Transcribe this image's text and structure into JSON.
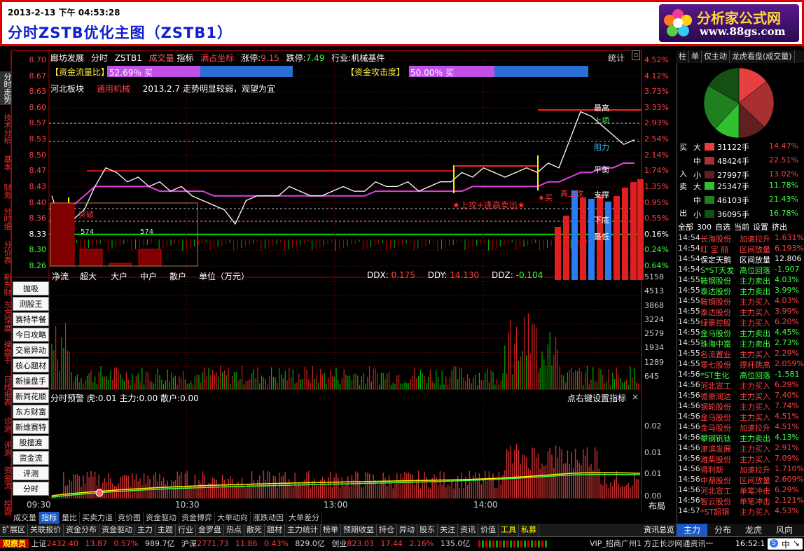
{
  "header": {
    "datetime": "2013-2-13 下午 04:53:28",
    "title": "分时ZSTB优化主图（ZSTB1）",
    "logo_title": "分析家公式网",
    "logo_url_text": "www.88gs.com"
  },
  "vertical_tabs": [
    "分时走势",
    "技术分析",
    "基本",
    "财务",
    "分时细",
    "分价表",
    "新东财",
    "东方深度",
    "操盘手",
    "日线报表",
    "诊测",
    "评测",
    "资金流",
    "控盘"
  ],
  "info_bar": {
    "stock": "廊坊发展",
    "mode": "分时",
    "formula": "ZSTB1",
    "volume_label": "成交量",
    "indicator_label": "指标",
    "coord_label": "满占坐标",
    "limit_up_label": "涨停:",
    "limit_up": "9.15",
    "limit_down_label": "跌停:",
    "limit_down": "7.49",
    "industry": "行业:机械基件",
    "stats": "统计"
  },
  "fund_bars": {
    "flow_label": "【资金流量比】",
    "flow_value": "52.69％ 买",
    "flow_fill": 0.53,
    "attack_label": "【资金攻击度】",
    "attack_value": "50.00％ 买",
    "attack_fill": 0.5
  },
  "board_line": {
    "board": "河北板块",
    "sector": "通用机械",
    "note": "2013.2.7 走势明显较弱，观望为宜"
  },
  "price_axis": [
    "8.70",
    "8.67",
    "8.63",
    "8.60",
    "8.57",
    "8.53",
    "8.50",
    "8.47",
    "8.43",
    "8.40",
    "8.36",
    "8.33",
    "8.30",
    "8.26"
  ],
  "pct_axis": [
    "4.52%",
    "4.12%",
    "3.73%",
    "3.33%",
    "2.93%",
    "2.54%",
    "2.14%",
    "1.74%",
    "1.35%",
    "0.95%",
    "0.55%",
    "0.16%",
    "0.24%",
    "0.64%"
  ],
  "levels": {
    "high": "最高",
    "upper": "上项",
    "resist": "阻力",
    "balance": "平衡",
    "support": "支撑",
    "bottom": "下底",
    "lowest": "最低"
  },
  "annotations": {
    "sell_signal": "★上攻+逢高卖出★",
    "buy_signal": "★买",
    "breakout": "突破",
    "cost": "574",
    "cost2": "574",
    "note_left": "高上攻"
  },
  "order_bars": {
    "labels": [
      "净流",
      "超大",
      "大户",
      "中户",
      "散户"
    ],
    "unit": "单位（万元）",
    "ddx_label": "DDX:",
    "ddx": "0.175",
    "ddy_label": "DDY:",
    "ddy": "14.130",
    "ddz_label": "DDZ:",
    "ddz": "-0.104"
  },
  "side_buttons": [
    "抛吸",
    "测股王",
    "赛特早餐",
    "今日攻略",
    "交易异动",
    "核心题材",
    "新操盘手",
    "新同花顺",
    "东方财富",
    "新维赛特",
    "股摆渡",
    "资金流",
    "评测",
    "分时MACD"
  ],
  "volume_axis": [
    "5158",
    "4513",
    "3868",
    "3224",
    "2579",
    "1934",
    "1289",
    "645"
  ],
  "indicator_panel": {
    "title": "分时预警",
    "tiger": "虎:0.01",
    "main": "主力:0.00",
    "retail": "散户:0.00",
    "hint": "点右键设置指标",
    "close": "×",
    "axis": [
      "0.02",
      "0.01",
      "0.01",
      "0.00"
    ]
  },
  "time_axis": [
    "09:30",
    "10:30",
    "13:00",
    "14:00"
  ],
  "layout_label": "布局",
  "bottom_tabs_1": [
    "成交量",
    "指标",
    "量比",
    "买卖力道",
    "竞价图",
    "资金驱动",
    "资金博弈",
    "大单动向",
    "涨跌动因",
    "大单差分"
  ],
  "bottom_tabs_1_selected": 1,
  "bottom_tabs_2": [
    "扩展区",
    "关联报价",
    "资金分布",
    "资金驱动",
    "主力",
    "主题",
    "行业",
    "金罗盘",
    "热点",
    "散死",
    "题材",
    "主力统计",
    "榜单",
    "预期收益",
    "持仓",
    "异动",
    "股东",
    "关注",
    "资讯",
    "价值",
    "工具",
    "私募"
  ],
  "bottom_right_tab": "资讯总览",
  "status": {
    "app": "观察员",
    "sh_label": "上证",
    "sh_index": "2432.40",
    "sh_chg": "13.87",
    "sh_pct": "0.57%",
    "sh_amt": "989.7亿",
    "hs_label": "沪深",
    "hs_index": "2771.73",
    "hs_chg": "11.86",
    "hs_pct": "0.43%",
    "hs_amt": "829.0亿",
    "cy_label": "创业",
    "cy_index": "823.03",
    "cy_chg": "17.44",
    "cy_pct": "2.16%",
    "cy_amt": "135.0亿",
    "broker": "VIP_招商广州1 方正长沙网通资讯一",
    "clock": "16:52:1"
  },
  "right_panel": {
    "tabs": [
      "柱",
      "单",
      "仅主动",
      "龙虎看盘(成交量)"
    ],
    "buy_side": "买",
    "in_label": "入",
    "sell_side": "卖",
    "out_label": "出",
    "buy_rows": [
      {
        "size": "大",
        "hands": "31122手",
        "pct": "14.47%",
        "color": "#e84040"
      },
      {
        "size": "中",
        "hands": "48424手",
        "pct": "22.51%",
        "color": "#a83030"
      },
      {
        "size": "小",
        "hands": "27997手",
        "pct": "13.02%",
        "color": "#602020"
      }
    ],
    "sell_rows": [
      {
        "size": "大",
        "hands": "25347手",
        "pct": "11.78%",
        "color": "#30c030"
      },
      {
        "size": "中",
        "hands": "46103手",
        "pct": "21.43%",
        "color": "#208020"
      },
      {
        "size": "小",
        "hands": "36095手",
        "pct": "16.78%",
        "color": "#145014"
      }
    ],
    "pie": [
      14.47,
      22.51,
      13.02,
      11.78,
      21.43,
      16.78
    ],
    "filter_tabs": [
      "全部",
      "300",
      "自选",
      "当前",
      "设置",
      "挤出"
    ],
    "ticker": [
      {
        "t": "14:54",
        "name": "长海股份",
        "act": "加速拉升",
        "v": "1.631%",
        "c": "r"
      },
      {
        "t": "14:54",
        "name": "红 宝 丽",
        "act": "区间放量",
        "v": "6.193%",
        "c": "r"
      },
      {
        "t": "14:54",
        "name": "保定天鹅",
        "act": "区间放量",
        "v": "12.806",
        "c": "w"
      },
      {
        "t": "14:54",
        "name": "S*ST天发",
        "act": "高位回落",
        "v": "-1.907",
        "c": "g"
      },
      {
        "t": "14:55",
        "name": "鞍钢股份",
        "act": "主力卖出",
        "v": "4.03%",
        "c": "g"
      },
      {
        "t": "14:55",
        "name": "泰达股份",
        "act": "主力卖出",
        "v": "3.99%",
        "c": "g"
      },
      {
        "t": "14:55",
        "name": "鞍钢股份",
        "act": "主力买入",
        "v": "4.03%",
        "c": "r"
      },
      {
        "t": "14:55",
        "name": "泰达股份",
        "act": "主力买入",
        "v": "3.99%",
        "c": "r"
      },
      {
        "t": "14:55",
        "name": "绿景控股",
        "act": "主力买入",
        "v": "6.20%",
        "c": "r"
      },
      {
        "t": "14:55",
        "name": "金马股份",
        "act": "主力卖出",
        "v": "4.45%",
        "c": "g"
      },
      {
        "t": "14:55",
        "name": "珠海中富",
        "act": "主力卖出",
        "v": "2.73%",
        "c": "g"
      },
      {
        "t": "14:55",
        "name": "名流置业",
        "act": "主力买入",
        "v": "2.29%",
        "c": "r"
      },
      {
        "t": "14:55",
        "name": "零七股份",
        "act": "撑杆跳高",
        "v": "2.059%",
        "c": "r"
      },
      {
        "t": "14:56",
        "name": "*ST生化",
        "act": "高位回落",
        "v": "-1.581",
        "c": "g"
      },
      {
        "t": "14:56",
        "name": "河北宣工",
        "act": "主力买入",
        "v": "6.29%",
        "c": "r"
      },
      {
        "t": "14:56",
        "name": "德豪润达",
        "act": "主力买入",
        "v": "7.40%",
        "c": "r"
      },
      {
        "t": "14:56",
        "name": "钢轮股份",
        "act": "主力买入",
        "v": "7.74%",
        "c": "r"
      },
      {
        "t": "14:56",
        "name": "金马股份",
        "act": "主力买入",
        "v": "4.51%",
        "c": "r"
      },
      {
        "t": "14:56",
        "name": "金马股份",
        "act": "加速拉升",
        "v": "4.51%",
        "c": "r"
      },
      {
        "t": "14:56",
        "name": "攀钢钒钛",
        "act": "主力卖出",
        "v": "4.13%",
        "c": "g"
      },
      {
        "t": "14:56",
        "name": "津滨发展",
        "act": "主力买入",
        "v": "2.91%",
        "c": "r"
      },
      {
        "t": "14:56",
        "name": "潍柴股份",
        "act": "主力买入",
        "v": "7.09%",
        "c": "r"
      },
      {
        "t": "14:56",
        "name": "得利斯",
        "act": "加速拉升",
        "v": "1.710%",
        "c": "r"
      },
      {
        "t": "14:56",
        "name": "中鼎股份",
        "act": "区间放量",
        "v": "2.609%",
        "c": "r"
      },
      {
        "t": "14:56",
        "name": "河北宣工",
        "act": "单笔冲击",
        "v": "6.29%",
        "c": "r"
      },
      {
        "t": "14:56",
        "name": "智云股份",
        "act": "单笔冲击",
        "v": "2.121%",
        "c": "r"
      },
      {
        "t": "14:57",
        "name": "*ST韶钢",
        "act": "主力买入",
        "v": "4.53%",
        "c": "r"
      }
    ],
    "bottom_tabs": [
      "主力",
      "分布",
      "龙虎",
      "风向"
    ],
    "bottom_selected": 0
  },
  "chart_data": {
    "type": "line",
    "price_series": [
      8.41,
      8.34,
      8.36,
      8.38,
      8.43,
      8.47,
      8.46,
      8.44,
      8.45,
      8.43,
      8.44,
      8.42,
      8.43,
      8.41,
      8.4,
      8.39,
      8.38,
      8.35,
      8.4,
      8.41,
      8.41,
      8.41,
      8.43,
      8.42,
      8.41,
      8.41,
      8.42,
      8.43,
      8.42,
      8.42,
      8.44,
      8.43,
      8.43,
      8.44,
      8.42,
      8.43,
      8.44,
      8.44,
      8.46,
      8.45,
      8.47,
      8.46,
      8.45,
      8.46,
      8.47,
      8.46,
      8.48,
      8.47,
      8.53,
      8.59,
      8.58,
      8.56,
      8.54,
      8.52,
      8.53
    ],
    "avg_series": [
      8.38,
      8.37,
      8.39,
      8.41,
      8.43,
      8.43,
      8.43,
      8.43,
      8.43,
      8.43,
      8.42,
      8.42,
      8.42,
      8.42,
      8.42,
      8.41,
      8.41,
      8.41,
      8.41,
      8.41,
      8.41,
      8.41,
      8.41,
      8.41,
      8.41,
      8.41,
      8.41,
      8.41,
      8.41,
      8.41,
      8.42,
      8.42,
      8.42,
      8.42,
      8.42,
      8.42,
      8.42,
      8.42,
      8.42,
      8.43,
      8.43,
      8.43,
      8.43,
      8.43,
      8.43,
      8.43,
      8.44,
      8.44,
      8.45,
      8.46,
      8.46,
      8.47,
      8.47,
      8.48,
      8.48
    ],
    "ylim": [
      8.26,
      8.7
    ]
  }
}
